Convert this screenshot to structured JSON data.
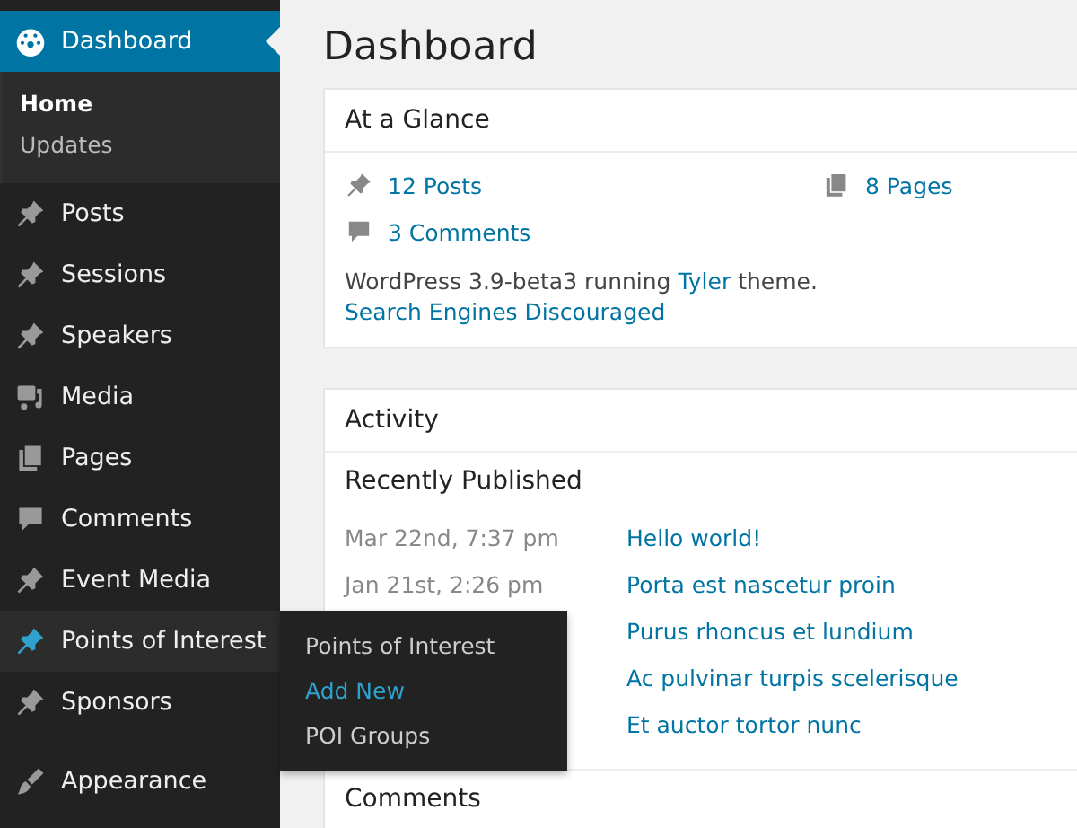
{
  "sidebar": {
    "items": [
      {
        "label": "Dashboard",
        "kind": "gauge",
        "selected": true,
        "submenu": [
          {
            "label": "Home",
            "selected": true
          },
          {
            "label": "Updates",
            "selected": false
          }
        ]
      },
      {
        "label": "Posts",
        "kind": "pin",
        "selected": false
      },
      {
        "label": "Sessions",
        "kind": "pin",
        "selected": false
      },
      {
        "label": "Speakers",
        "kind": "pin",
        "selected": false
      },
      {
        "label": "Media",
        "kind": "media",
        "selected": false
      },
      {
        "label": "Pages",
        "kind": "pages",
        "selected": false
      },
      {
        "label": "Comments",
        "kind": "comment",
        "selected": false
      },
      {
        "label": "Event Media",
        "kind": "pin",
        "selected": false
      },
      {
        "label": "Points of Interest",
        "kind": "pin",
        "selected": false,
        "hovered": true,
        "flyout": [
          {
            "label": "Points of Interest",
            "hovered": false
          },
          {
            "label": "Add New",
            "hovered": true
          },
          {
            "label": "POI Groups",
            "hovered": false
          }
        ]
      },
      {
        "label": "Sponsors",
        "kind": "pin",
        "selected": false
      },
      {
        "label": "Appearance",
        "kind": "brush",
        "selected": false,
        "separated": true
      }
    ]
  },
  "page_title": "Dashboard",
  "at_a_glance": {
    "title": "At a Glance",
    "stats": [
      {
        "kind": "pin",
        "label": "12 Posts"
      },
      {
        "kind": "pages",
        "label": "8 Pages"
      },
      {
        "kind": "comment",
        "label": "3 Comments"
      }
    ],
    "version_text": "WordPress 3.9-beta3 running ",
    "theme_link": "Tyler",
    "version_suffix": " theme.",
    "search_engines": "Search Engines Discouraged"
  },
  "activity": {
    "title": "Activity",
    "section": "Recently Published",
    "rows": [
      {
        "date": "Mar 22nd, 7:37 pm",
        "title": "Hello world!"
      },
      {
        "date": "Jan 21st, 2:26 pm",
        "title": "Porta est nascetur proin"
      },
      {
        "title": "Purus rhoncus et lundium"
      },
      {
        "title": "Ac pulvinar turpis scelerisque"
      },
      {
        "title": "Et auctor tortor nunc"
      }
    ],
    "next_section": "Comments"
  }
}
